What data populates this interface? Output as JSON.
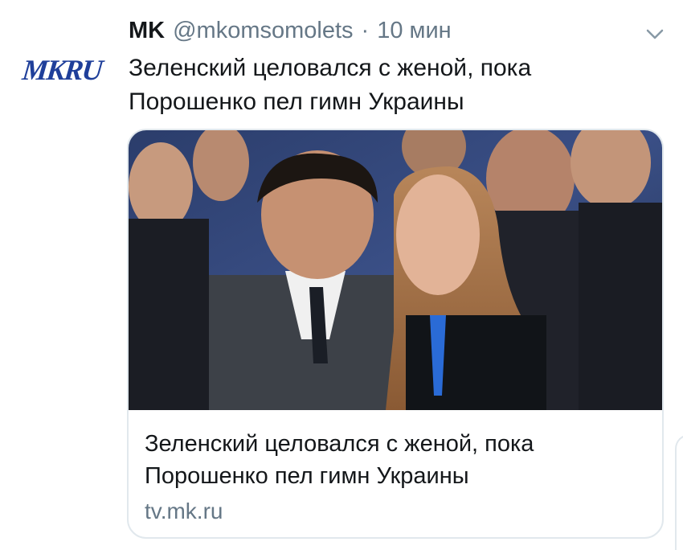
{
  "tweet": {
    "author_name": "MK",
    "handle": "@mkomsomolets",
    "separator": "·",
    "time": "10 мин",
    "avatar_text": "MKRU",
    "text_line1": "Зеленский целовался с женой, пока",
    "text_line2": "Порошенко пел гимн Украины"
  },
  "card": {
    "title_line1": "Зеленский целовался с женой, пока",
    "title_line2": "Порошенко пел гимн Украины",
    "domain": "tv.mk.ru"
  },
  "colors": {
    "text": "#14171a",
    "secondary": "#657786",
    "border": "#e1e8ed",
    "logo": "#1f3f9a"
  },
  "icons": {
    "menu": "chevron-down-icon"
  }
}
